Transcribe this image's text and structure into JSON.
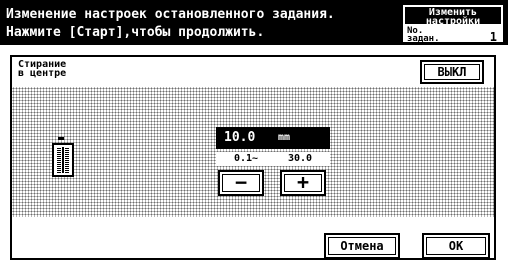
{
  "header": {
    "message_line1": "Изменение настроек остановленного задания.",
    "message_line2": "Нажмите [Старт],чтобы продолжить."
  },
  "job_box": {
    "change_label_line1": "Изменить",
    "change_label_line2": "настройки",
    "job_no_label_line1": "No.",
    "job_no_label_line2": "задан.",
    "job_number": "1"
  },
  "panel": {
    "title_line1": "Стирание",
    "title_line2": "в центре",
    "off_button_label": "ВЫКЛ",
    "value": "10.0",
    "unit": "mm",
    "range_min": "0.1~",
    "range_max": "30.0",
    "minus_label": "−",
    "plus_label": "+",
    "icon": "center-erase-icon"
  },
  "footer": {
    "cancel_label": "Отмена",
    "ok_label": "OK"
  }
}
